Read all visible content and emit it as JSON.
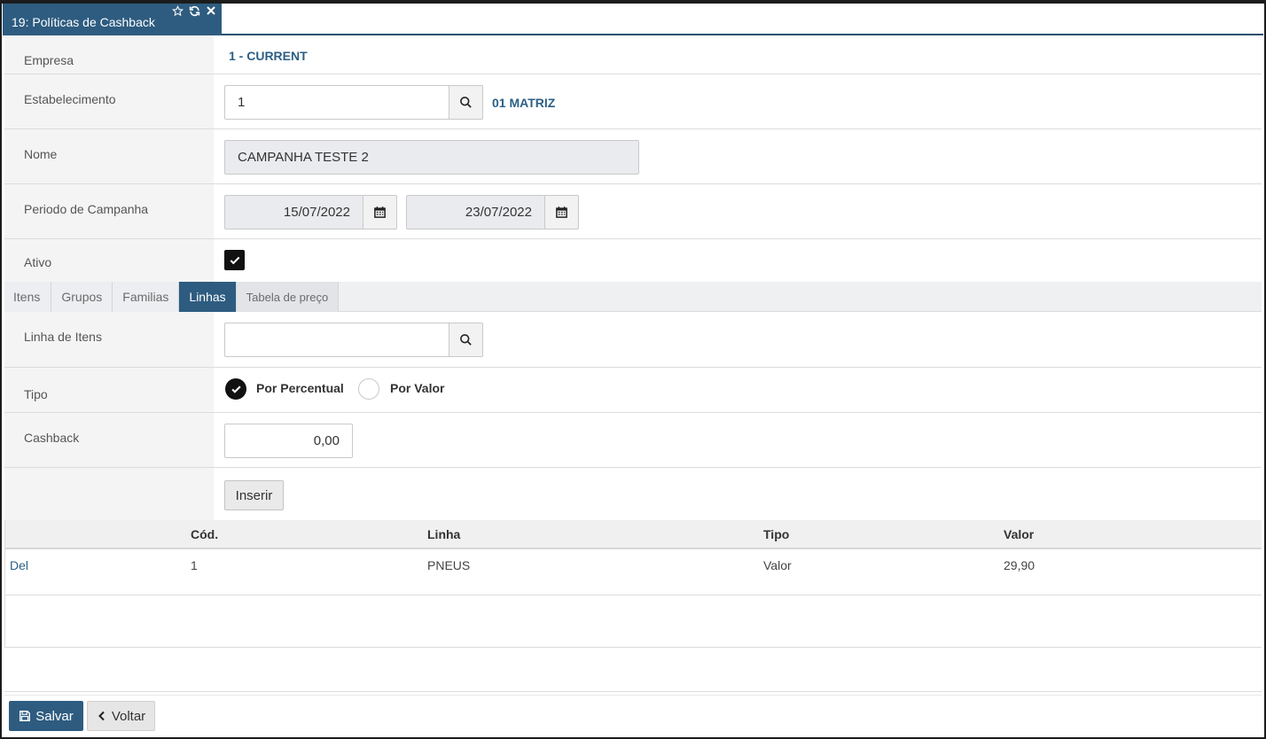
{
  "window": {
    "tab_title": "19: Políticas de Cashback"
  },
  "form": {
    "empresa": {
      "label": "Empresa",
      "value": "1 - CURRENT"
    },
    "estabelecimento": {
      "label": "Estabelecimento",
      "value": "1",
      "description": "01 MATRIZ"
    },
    "nome": {
      "label": "Nome",
      "value": "CAMPANHA TESTE 2"
    },
    "periodo": {
      "label": "Periodo de Campanha",
      "start": "15/07/2022",
      "end": "23/07/2022"
    },
    "ativo": {
      "label": "Ativo",
      "checked": true
    }
  },
  "subtabs": [
    "Itens",
    "Grupos",
    "Familias",
    "Linhas",
    "Tabela de preço"
  ],
  "linhas_form": {
    "linha": {
      "label": "Linha de Itens",
      "value": ""
    },
    "tipo": {
      "label": "Tipo",
      "option_percent": "Por Percentual",
      "option_value": "Por Valor",
      "selected": "Por Percentual"
    },
    "cashback": {
      "label": "Cashback",
      "value": "0,00"
    },
    "insert_label": "Inserir"
  },
  "table": {
    "headers": {
      "cod": "Cód.",
      "linha": "Linha",
      "tipo": "Tipo",
      "valor": "Valor"
    },
    "rows": [
      {
        "action": "Del",
        "cod": "1",
        "linha": "PNEUS",
        "tipo": "Valor",
        "valor": "29,90"
      }
    ]
  },
  "footer": {
    "save_label": "Salvar",
    "back_label": "Voltar"
  },
  "colors": {
    "primary": "#2e5c80",
    "link": "#2c5f85"
  }
}
